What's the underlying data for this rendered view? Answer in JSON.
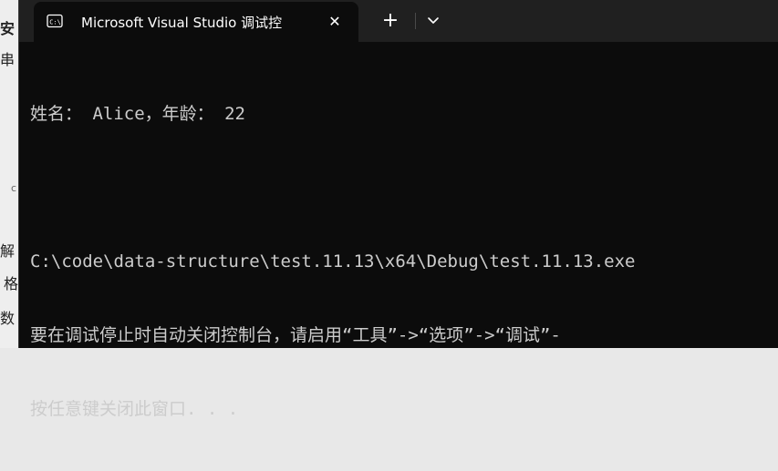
{
  "background_window": {
    "fragments": [
      "安",
      "串",
      "c",
      "解",
      "格",
      "数"
    ]
  },
  "tab": {
    "title": "Microsoft Visual Studio 调试控",
    "icon": "terminal-icon",
    "close_symbol": "✕"
  },
  "titlebar": {
    "new_tab_symbol": "+",
    "dropdown_icon": "chevron-down-icon"
  },
  "console": {
    "line1": "姓名： Alice，年龄： 22",
    "line2": "",
    "line3": "C:\\code\\data-structure\\test.11.13\\x64\\Debug\\test.11.13.exe",
    "line4": "要在调试停止时自动关闭控制台，请启用“工具”->“选项”->“调试”-",
    "line5": "按任意键关闭此窗口. . ."
  },
  "colors": {
    "terminal_bg": "#0c0c0c",
    "titlebar_bg": "#202020",
    "text": "#cccccc"
  }
}
